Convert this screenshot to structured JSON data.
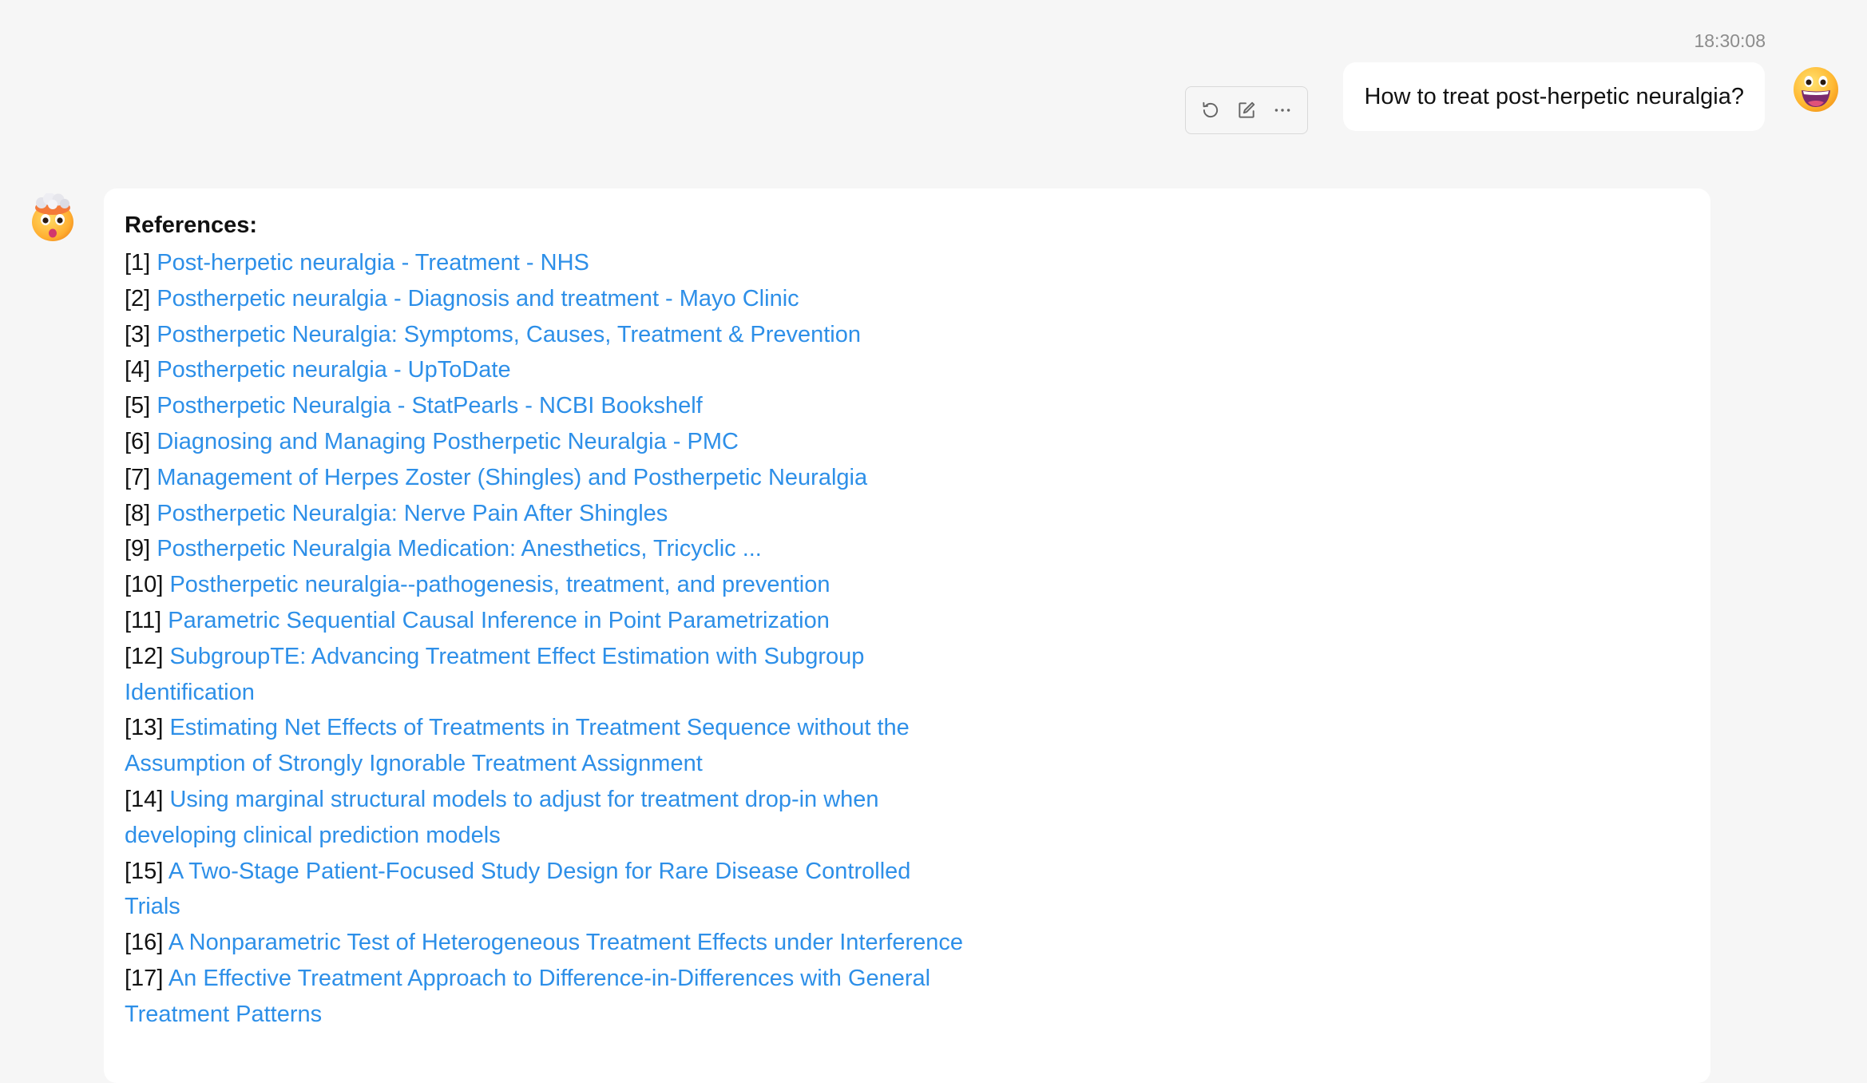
{
  "conversation": {
    "timestamp": "18:30:08",
    "user_message": "How to treat post-herpetic neuralgia?",
    "toolbar": {
      "icons": [
        "refresh-icon",
        "edit-icon",
        "more-icon"
      ]
    },
    "answer": {
      "heading": "References:",
      "references": [
        {
          "num": "[1]",
          "title": "Post-herpetic neuralgia - Treatment - NHS"
        },
        {
          "num": "[2]",
          "title": "Postherpetic neuralgia - Diagnosis and treatment - Mayo Clinic"
        },
        {
          "num": "[3]",
          "title": "Postherpetic Neuralgia: Symptoms, Causes, Treatment & Prevention"
        },
        {
          "num": "[4]",
          "title": "Postherpetic neuralgia - UpToDate"
        },
        {
          "num": "[5]",
          "title": "Postherpetic Neuralgia - StatPearls - NCBI Bookshelf"
        },
        {
          "num": "[6]",
          "title": "Diagnosing and Managing Postherpetic Neuralgia - PMC"
        },
        {
          "num": "[7]",
          "title": "Management of Herpes Zoster (Shingles) and Postherpetic Neuralgia"
        },
        {
          "num": "[8]",
          "title": "Postherpetic Neuralgia: Nerve Pain After Shingles"
        },
        {
          "num": "[9]",
          "title": "Postherpetic Neuralgia Medication: Anesthetics, Tricyclic ..."
        },
        {
          "num": "[10]",
          "title": "Postherpetic neuralgia--pathogenesis, treatment, and prevention"
        },
        {
          "num": "[11]",
          "title": "Parametric Sequential Causal Inference in Point Parametrization"
        },
        {
          "num": "[12]",
          "title": "SubgroupTE: Advancing Treatment Effect Estimation with Subgroup Identification"
        },
        {
          "num": "[13]",
          "title": "Estimating Net Effects of Treatments in Treatment Sequence without the Assumption of Strongly Ignorable Treatment Assignment"
        },
        {
          "num": "[14]",
          "title": "Using marginal structural models to adjust for treatment drop-in when developing clinical prediction models"
        },
        {
          "num": "[15]",
          "title": "A Two-Stage Patient-Focused Study Design for Rare Disease Controlled Trials"
        },
        {
          "num": "[16]",
          "title": "A Nonparametric Test of Heterogeneous Treatment Effects under Interference"
        },
        {
          "num": "[17]",
          "title": "An Effective Treatment Approach to Difference-in-Differences with General Treatment Patterns"
        }
      ]
    }
  },
  "colors": {
    "link": "#2d8fe8",
    "background": "#f6f6f6",
    "card": "#ffffff",
    "timestamp": "#8c8c8c"
  }
}
